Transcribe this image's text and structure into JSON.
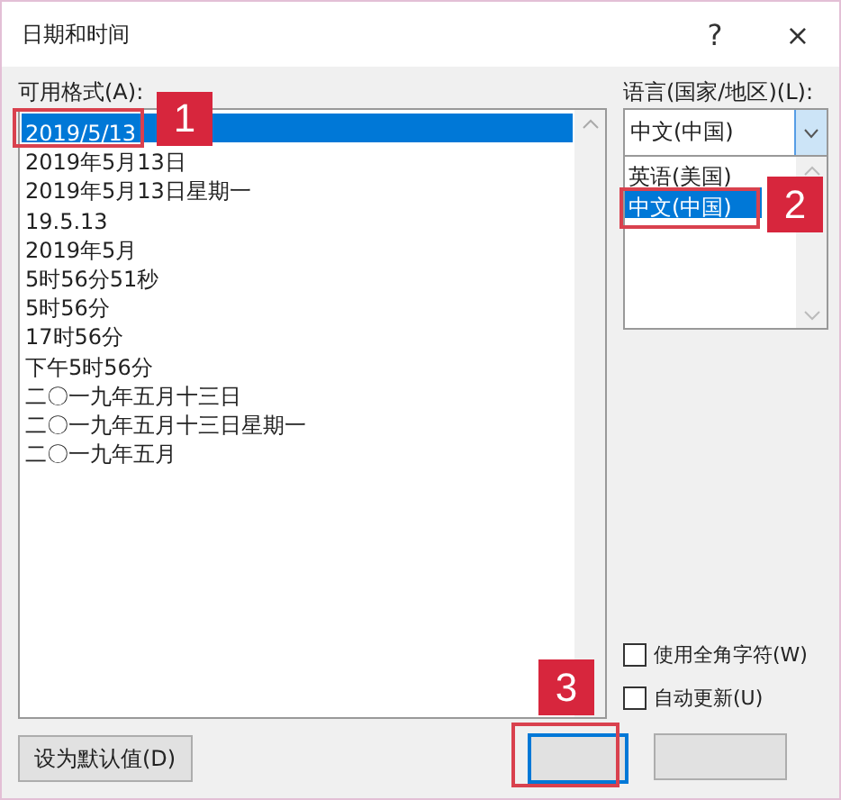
{
  "window": {
    "title": "日期和时间",
    "help": "?",
    "close": "×"
  },
  "formats": {
    "label": "可用格式(A):",
    "items": [
      {
        "text": "2019/5/13",
        "selected": true
      },
      {
        "text": "2019年5月13日",
        "selected": false
      },
      {
        "text": "2019年5月13日星期一",
        "selected": false
      },
      {
        "text": "19.5.13",
        "selected": false
      },
      {
        "text": "2019年5月",
        "selected": false
      },
      {
        "text": "5时56分51秒",
        "selected": false
      },
      {
        "text": "5时56分",
        "selected": false
      },
      {
        "text": "17时56分",
        "selected": false
      },
      {
        "text": "下午5时56分",
        "selected": false
      },
      {
        "text": "二〇一九年五月十三日",
        "selected": false
      },
      {
        "text": "二〇一九年五月十三日星期一",
        "selected": false
      },
      {
        "text": "二〇一九年五月",
        "selected": false
      }
    ]
  },
  "language": {
    "label": "语言(国家/地区)(L):",
    "value": "中文(中国)",
    "expanded": true,
    "options": [
      {
        "text": "英语(美国)",
        "selected": false
      },
      {
        "text": "中文(中国)",
        "selected": true
      }
    ]
  },
  "checkboxes": [
    {
      "label": "使用全角字符(W)",
      "checked": false
    },
    {
      "label": "自动更新(U)",
      "checked": false
    }
  ],
  "buttons": {
    "default": "设为默认值(D)"
  },
  "annotations": [
    {
      "label": "1"
    },
    {
      "label": "2"
    },
    {
      "label": "3"
    }
  ]
}
